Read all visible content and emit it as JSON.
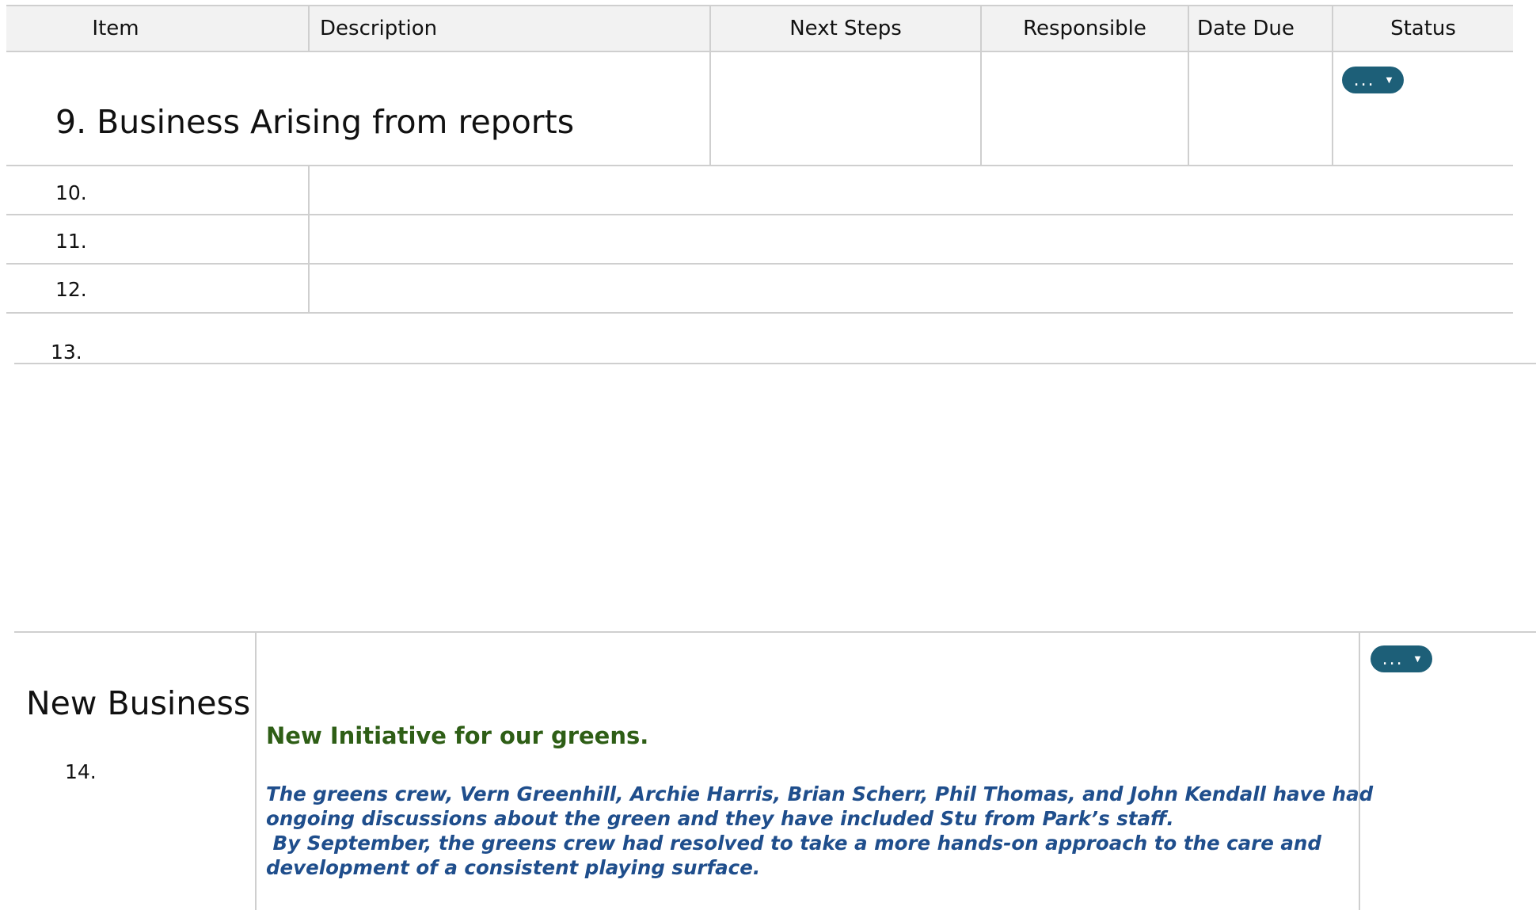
{
  "table": {
    "headers": {
      "item": "Item",
      "description": "Description",
      "next_steps": "Next Steps",
      "responsible": "Responsible",
      "date_due": "Date Due",
      "status": "Status"
    },
    "section_title": "9. Business Arising from reports",
    "status_button_label": "...",
    "rows": [
      "10.",
      "11.",
      "12.",
      "13."
    ]
  },
  "new_business": {
    "title": "New Business",
    "item_number": "14.",
    "initiative_title": "New Initiative for our greens.",
    "paragraph_lines": [
      "The greens crew, Vern Greenhill, Archie Harris, Brian Scherr, Phil Thomas, and John Kendall have had",
      "ongoing discussions about the green and they have included Stu from Park’s staff.",
      " By September, the greens crew had resolved to take a more hands-on approach to the care and",
      "development of a consistent playing surface."
    ],
    "status_button_label": "..."
  },
  "colors": {
    "status_button": "#1d5f78",
    "initiative_title": "#2e5e16",
    "paragraph_text": "#1f4e8c",
    "grid_line": "#cfcfcf",
    "header_bg": "#f2f2f2"
  }
}
